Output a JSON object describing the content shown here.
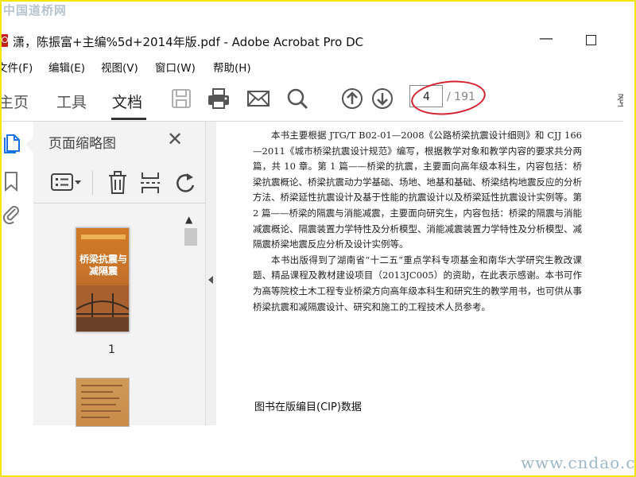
{
  "watermark": {
    "top": "中国道桥网",
    "bottom": "www.cndao.com"
  },
  "window": {
    "title": "潇，陈振富+主编%5d+2014年版.pdf - Adobe Acrobat Pro DC",
    "minimize_icon": "minimize-icon",
    "maximize_icon": "maximize-icon"
  },
  "menu": [
    {
      "label": "文件(F)"
    },
    {
      "label": "编辑(E)"
    },
    {
      "label": "视图(V)"
    },
    {
      "label": "窗口(W)"
    },
    {
      "label": "帮助(H)"
    }
  ],
  "toolbar": {
    "tabs": [
      {
        "label": "主页"
      },
      {
        "label": "工具"
      },
      {
        "label": "文档",
        "active": true
      }
    ],
    "icons": [
      "save-icon",
      "print-icon",
      "email-icon",
      "search-icon",
      "page-up-icon",
      "page-down-icon"
    ],
    "page_current": "4",
    "page_total": "/ 191",
    "right_cut_label": "登"
  },
  "left_rail": {
    "icons": [
      "page-thumbnails-icon",
      "bookmark-icon",
      "attachment-icon"
    ]
  },
  "thumbnail_panel": {
    "title": "页面缩略图",
    "close_icon": "close-icon",
    "tools": [
      "page-options-icon",
      "delete-icon",
      "extract-icon",
      "rotate-icon"
    ],
    "thumbnails": [
      {
        "page": "1",
        "cover_title": "桥梁抗震与减隔震"
      },
      {
        "page": "",
        "cover_title": ""
      }
    ]
  },
  "document": {
    "paragraphs": [
      "本书主要根据 JTG/T B02-01—2008《公路桥梁抗震设计细则》和 CJJ 166—2011《城市桥梁抗震设计规范》编写，根据教学对象和教学内容的要求共分两篇，共 10 章。第 1 篇——桥梁的抗震，主要面向高年级本科生，内容包括：桥梁抗震概论、桥梁抗震动力学基础、场地、地基和基础、桥梁结构地震反应的分析方法、桥梁延性抗震设计及基于性能的抗震设计以及桥梁延性抗震设计实例等。第 2 篇——桥梁的隔震与消能减震，主要面向研究生，内容包括：桥梁的隔震与消能减震概论、隔震装置力学特性及分析模型、消能减震装置力学特性及分析模型、减隔震桥梁地震反应分析及设计实例等。",
      "本书出版得到了湖南省“十二五”重点学科专项基金和南华大学研究生教改课题、精品课程及教材建设项目（2013JC005）的资助，在此表示感谢。本书可作为高等院校土木工程专业桥梁方向高年级本科生和研究生的教学用书，也可供从事桥梁抗震和减隔震设计、研究和施工的工程技术人员参考。"
    ],
    "cip_heading": "图书在版编目(CIP)数据"
  },
  "colors": {
    "annotation_red": "#d2202c",
    "acrobat_red": "#c6201a",
    "border_yellow": "#f3e600"
  }
}
